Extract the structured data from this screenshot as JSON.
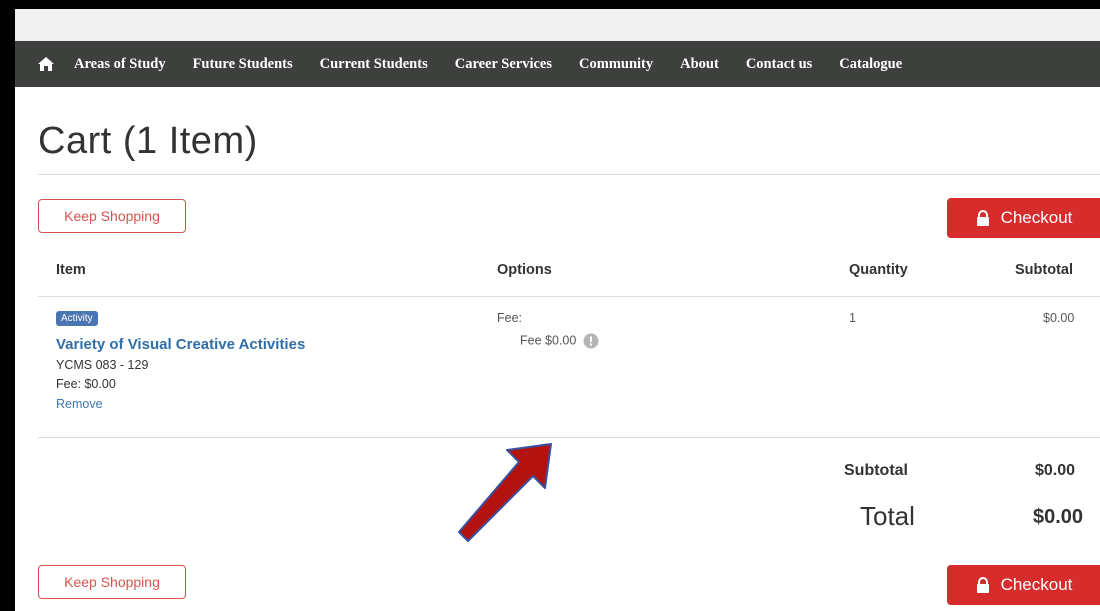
{
  "nav": {
    "items": [
      "Areas of Study",
      "Future Students",
      "Current Students",
      "Career Services",
      "Community",
      "About",
      "Contact us",
      "Catalogue"
    ]
  },
  "page": {
    "title": "Cart (1 Item)"
  },
  "buttons": {
    "keep_shopping": "Keep Shopping",
    "checkout": "Checkout"
  },
  "table": {
    "headers": {
      "item": "Item",
      "options": "Options",
      "quantity": "Quantity",
      "subtotal": "Subtotal"
    },
    "row": {
      "badge": "Activity",
      "name": "Variety of Visual Creative Activities",
      "code": "YCMS 083 - 129",
      "fee": "Fee: $0.00",
      "remove": "Remove",
      "option_label": "Fee:",
      "option_value": "Fee $0.00",
      "quantity": "1",
      "subtotal": "$0.00"
    }
  },
  "summary": {
    "subtotal_label": "Subtotal",
    "subtotal_value": "$0.00",
    "total_label": "Total",
    "total_value": "$0.00"
  },
  "colors": {
    "nav_bg": "#3e403e",
    "checkout_bg": "#d62c2c",
    "link": "#2f6fa7",
    "badge": "#4a77b4",
    "arrow": "#b3120f"
  }
}
